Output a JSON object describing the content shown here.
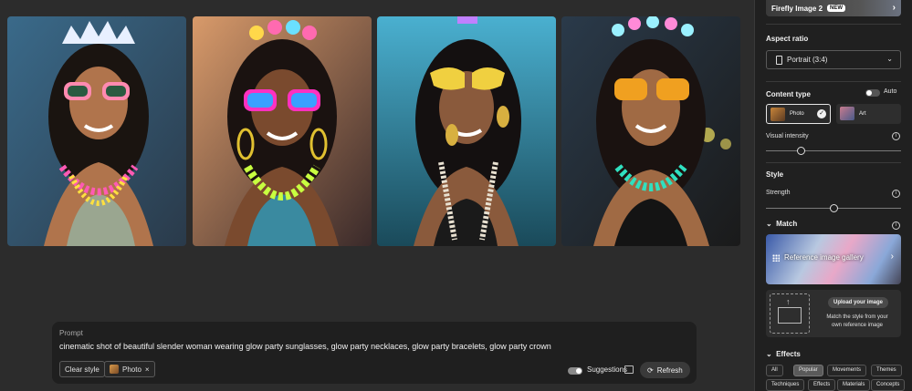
{
  "prompt": {
    "label": "Prompt",
    "text": "cinematic shot of beautiful slender woman wearing glow party sunglasses, glow party necklaces, glow party bracelets, glow party crown",
    "clear_style": "Clear style",
    "photo_chip": "Photo",
    "chip_close": "×",
    "suggestions": "Suggestions",
    "refresh": "Refresh"
  },
  "panel": {
    "model_name": "Firefly Image 2",
    "model_badge": "NEW",
    "aspect_ratio_title": "Aspect ratio",
    "aspect_ratio_value": "Portrait (3:4)",
    "content_type_title": "Content type",
    "auto_label": "Auto",
    "content_types": [
      {
        "label": "Photo",
        "selected": true
      },
      {
        "label": "Art",
        "selected": false
      }
    ],
    "visual_intensity_label": "Visual intensity",
    "visual_intensity_value": 0.26,
    "style_title": "Style",
    "strength_label": "Strength",
    "strength_value": 0.5,
    "match_title": "Match",
    "gallery_label": "Reference image gallery",
    "upload_button": "Upload your image",
    "upload_desc": "Match the style from your own reference image",
    "effects_title": "Effects",
    "effects_tabs": [
      "All",
      "Popular",
      "Movements",
      "Themes"
    ],
    "effects_tabs_row2": [
      "Techniques",
      "Effects",
      "Materials",
      "Concepts"
    ],
    "active_effect_tab": "Popular"
  },
  "colors": {
    "background": "#2c2c2c",
    "panel": "#202020",
    "prompt_bg": "#1f1f1f"
  },
  "icons": {
    "chevron_right": "›",
    "chevron_down": "⌄",
    "info": "i",
    "check": "✓",
    "refresh": "⟳"
  }
}
